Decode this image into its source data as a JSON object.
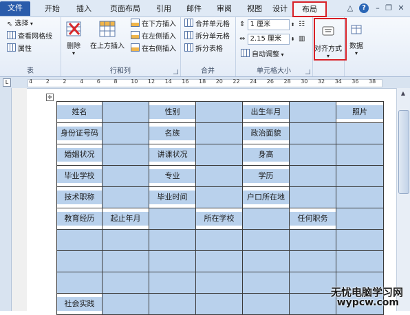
{
  "tabs": [
    {
      "label": "文件"
    },
    {
      "label": "开始"
    },
    {
      "label": "插入"
    },
    {
      "label": "页面布局"
    },
    {
      "label": "引用"
    },
    {
      "label": "邮件"
    },
    {
      "label": "审阅"
    },
    {
      "label": "视图"
    },
    {
      "label": "设计"
    },
    {
      "label": "布局"
    }
  ],
  "window_controls": {
    "help": "?"
  },
  "ribbon": {
    "table_group": {
      "label": "表",
      "select": "选择",
      "gridlines": "查看网格线",
      "properties": "属性"
    },
    "rows_cols_group": {
      "label": "行和列",
      "delete": "删除",
      "insert_above": "在上方插入",
      "insert_below": "在下方插入",
      "insert_left": "在左侧插入",
      "insert_right": "在右侧插入"
    },
    "merge_group": {
      "label": "合并",
      "merge_cells": "合并单元格",
      "split_cells": "拆分单元格",
      "split_table": "拆分表格"
    },
    "cell_size_group": {
      "label": "单元格大小",
      "height": "1 厘米",
      "width": "2.15 厘米",
      "autofit": "自动调整"
    },
    "alignment": {
      "label": "对齐方式"
    },
    "data": {
      "label": "数据"
    }
  },
  "ruler_numbers": [
    "4",
    "2",
    "2",
    "4",
    "6",
    "8",
    "10",
    "12",
    "14",
    "16",
    "18",
    "20",
    "22",
    "24",
    "26",
    "28",
    "30",
    "32",
    "34",
    "36",
    "38"
  ],
  "table_rows": [
    [
      "姓名",
      "",
      "性别",
      "",
      "出生年月",
      "",
      "照片"
    ],
    [
      "身份证号码",
      "",
      "名族",
      "",
      "政治面貌",
      "",
      ""
    ],
    [
      "婚姻状况",
      "",
      "讲课状况",
      "",
      "身高",
      "",
      ""
    ],
    [
      "毕业学校",
      "",
      "专业",
      "",
      "学历",
      "",
      ""
    ],
    [
      "技术职称",
      "",
      "毕业时间",
      "",
      "户口所在地",
      "",
      ""
    ],
    [
      "教育经历",
      "起止年月",
      "",
      "所在学校",
      "",
      "任何职务",
      ""
    ],
    [
      "",
      "",
      "",
      "",
      "",
      "",
      ""
    ],
    [
      "",
      "",
      "",
      "",
      "",
      "",
      ""
    ],
    [
      "",
      "",
      "",
      "",
      "",
      "",
      ""
    ],
    [
      "社会实践",
      "",
      "",
      "",
      "",
      "",
      ""
    ]
  ],
  "watermark": {
    "line1": "无忧电脑学习网",
    "line2": "wypcw.com"
  },
  "colors": {
    "selection": "#b9d1ec",
    "highlight_box": "#d81f26",
    "file_tab": "#2a5cab"
  }
}
